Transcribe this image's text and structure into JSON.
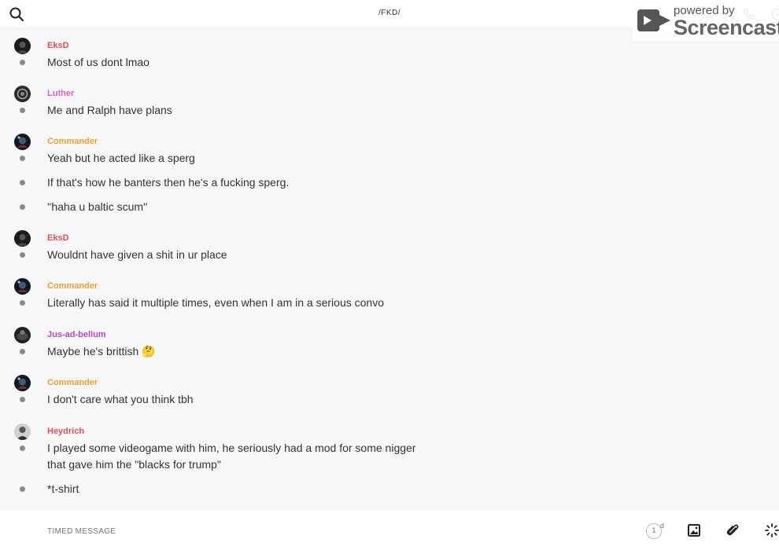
{
  "header": {
    "title": "/FKD/",
    "search_icon": "search-icon",
    "call_icon": "phone-icon",
    "info_icon": "info-icon"
  },
  "watermark": {
    "powered": "powered by",
    "brand": "Screencastify"
  },
  "colors": {
    "EksD": "#e05252",
    "Luther": "#d963c4",
    "Commander": "#f0a030",
    "Jus-ad-bellum": "#b545c9",
    "Heydrich": "#e05252"
  },
  "messages": [
    {
      "sender": "EksD",
      "lines": [
        "Most of us dont lmao"
      ]
    },
    {
      "sender": "Luther",
      "lines": [
        "Me and Ralph have plans"
      ]
    },
    {
      "sender": "Commander",
      "lines": [
        "Yeah but he acted like a sperg",
        "If that's how he banters then he's a fucking sperg.",
        "''haha u baltic scum''"
      ]
    },
    {
      "sender": "EksD",
      "lines": [
        "Wouldnt have given a shit in ur place"
      ]
    },
    {
      "sender": "Commander",
      "lines": [
        "Literally has said it multiple times, even when I am in a serious convo"
      ]
    },
    {
      "sender": "Jus-ad-bellum",
      "lines": [
        "Maybe he's brittish 🤔"
      ]
    },
    {
      "sender": "Commander",
      "lines": [
        "I don't care what you think tbh"
      ]
    },
    {
      "sender": "Heydrich",
      "lines": [
        "I played some videogame with him, he seriously had a mod for some nigger",
        "that gave him the \"blacks for trump\"",
        "*t-shirt"
      ]
    }
  ],
  "composer": {
    "placeholder": "TIMED MESSAGE",
    "timer_value": "1",
    "timer_unit": "d"
  }
}
